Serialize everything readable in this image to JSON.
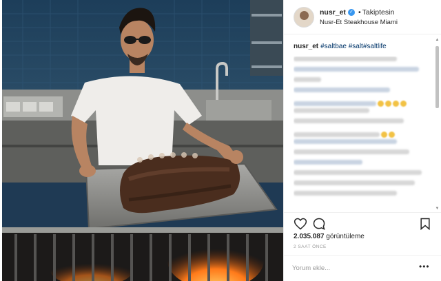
{
  "post": {
    "username": "nusr_et",
    "verified_icon": "verified-badge-icon",
    "separator": "•",
    "follow_status": "Takiptesin",
    "location": "Nusr-Et Steakhouse Miami",
    "caption_user": "nusr_et",
    "caption_tags": "#saltbae #salt#saltlife",
    "views_count": "2.035.087",
    "views_label": "görüntüleme",
    "timestamp": "2 SAAT ÖNCE",
    "comment_placeholder": "Yorum ekle...",
    "more_label": "•••"
  },
  "icons": {
    "like": "heart-icon",
    "comment": "comment-bubble-icon",
    "save": "bookmark-icon",
    "video": "play-icon"
  },
  "colors": {
    "link": "#003569",
    "verified": "#3897f0",
    "muted": "#999999",
    "text": "#262626"
  }
}
